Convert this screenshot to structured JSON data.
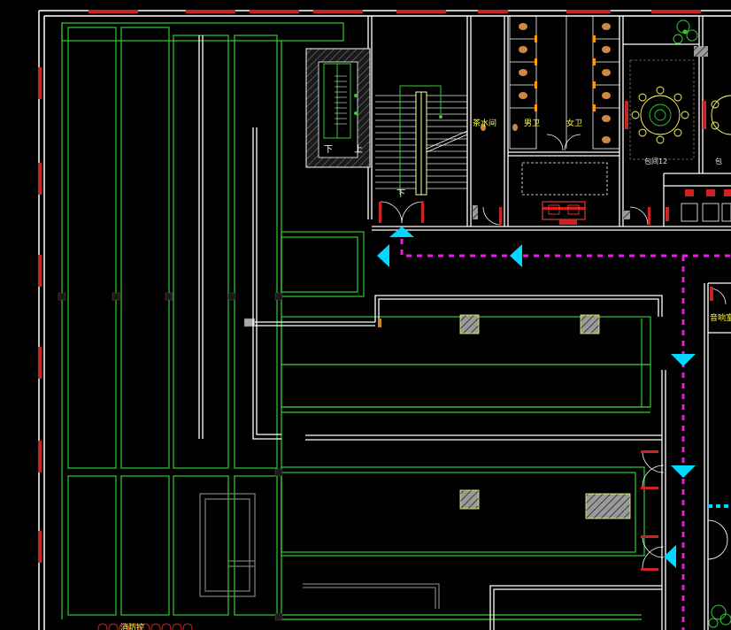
{
  "drawing": {
    "labels": {
      "tea_room": "茶水间",
      "male_wc": "男卫",
      "female_wc": "女卫",
      "private_room": "包间12",
      "private_room_right": "包",
      "stair_down_left": "下",
      "stair_up": "上",
      "stair_down_main": "下",
      "sound_control": "音响室",
      "bottom_partial": "消防控"
    },
    "colors": {
      "background": "#000000",
      "wall": "#ffffff",
      "grid_line": "#33cc33",
      "dashed_route": "#e61ee6",
      "arrow": "#00d8ff",
      "window": "#cc2222",
      "hatch_column": "#b5b5b5",
      "text": "#ffff33"
    },
    "icons": {
      "evacuation_arrow": "triangle-arrow-icon",
      "plant": "plant-icon",
      "round_table": "round-table-icon",
      "toilet": "toilet-icon",
      "door_swing": "door-swing-icon"
    }
  }
}
